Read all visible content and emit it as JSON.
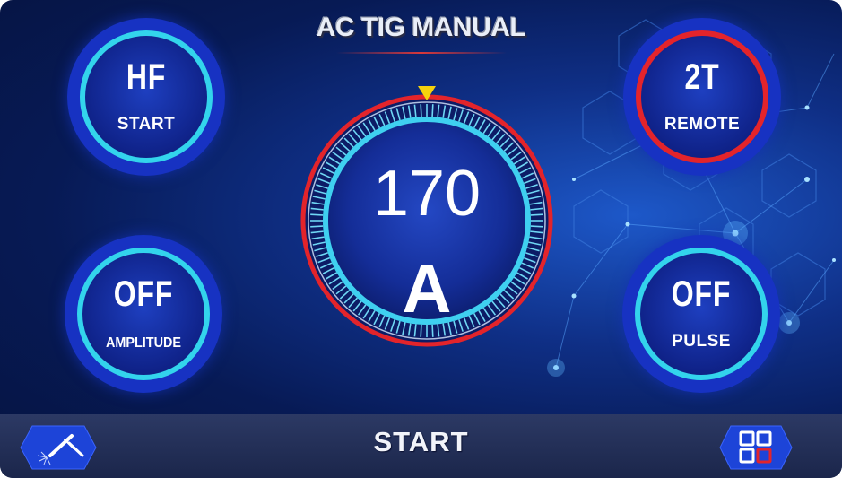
{
  "title": "AC TIG MANUAL",
  "buttons": {
    "hf": {
      "value": "HF",
      "label": "START"
    },
    "amplitude": {
      "value": "OFF",
      "label": "AMPLITUDE"
    },
    "trigger": {
      "value": "2T",
      "label": "REMOTE"
    },
    "pulse": {
      "value": "OFF",
      "label": "PULSE"
    }
  },
  "dial": {
    "value": "170",
    "unit": "A"
  },
  "bottom_bar": {
    "start_label": "START"
  },
  "icons": {
    "left": "welding-torch-icon",
    "right": "menu-grid-icon"
  },
  "colors": {
    "background": "#0b1f66",
    "button_fill": "#1732c2",
    "cyan_ring": "#33d4ec",
    "red_ring": "#e3242b",
    "indicator": "#f6d20c"
  }
}
